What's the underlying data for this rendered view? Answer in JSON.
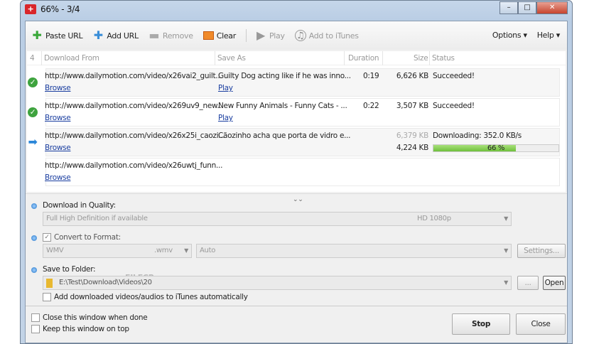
{
  "window": {
    "title": "66% - 3/4"
  },
  "toolbar": {
    "paste_url": "Paste URL",
    "add_url": "Add URL",
    "remove": "Remove",
    "clear": "Clear",
    "play": "Play",
    "add_to_itunes": "Add to iTunes",
    "options": "Options",
    "help": "Help"
  },
  "list": {
    "count": "4",
    "headers": {
      "from": "Download From",
      "save_as": "Save As",
      "duration": "Duration",
      "size": "Size",
      "status": "Status"
    },
    "rows": [
      {
        "url": "http://www.dailymotion.com/video/x26vai2_guilt...",
        "browse": "Browse",
        "save_as": "Guilty Dog acting like if he was inno...",
        "play": "Play",
        "duration": "0:19",
        "size": "6,626 KB",
        "status": "Succeeded!",
        "state": "done"
      },
      {
        "url": "http://www.dailymotion.com/video/x269uv9_new...",
        "browse": "Browse",
        "save_as": "New Funny Animals - Funny Cats - ...",
        "play": "Play",
        "duration": "0:22",
        "size": "3,507 KB",
        "status": "Succeeded!",
        "state": "done"
      },
      {
        "url": "http://www.dailymotion.com/video/x26x25i_caozi...",
        "browse": "Browse",
        "save_as": "Cãozinho acha que porta de vidro e...",
        "total_size": "6,379 KB",
        "size": "4,224 KB",
        "status": "Downloading: 352.0 KB/s",
        "progress": 66,
        "progress_label": "66 %",
        "state": "downloading"
      },
      {
        "url": "http://www.dailymotion.com/video/x26uwtj_funn...",
        "browse": "Browse",
        "state": "queued"
      }
    ]
  },
  "settings": {
    "quality_label": "Download in Quality:",
    "quality_value": "Full High Definition if available",
    "quality_res": "HD 1080p",
    "convert_label": "Convert to Format:",
    "format": "WMV",
    "format_ext": ".wmv",
    "format_option": "Auto",
    "settings_btn": "Settings...",
    "folder_label": "Save to Folder:",
    "folder_path": "E:\\Test\\Download\\Videos\\20",
    "browse_btn": "...",
    "open_btn": "Open",
    "itunes_label": "Add downloaded videos/audios to iTunes automatically",
    "watermark": "FILECR .com"
  },
  "bottom": {
    "close_when_done": "Close this window when done",
    "keep_on_top": "Keep this window on top",
    "stop": "Stop",
    "close": "Close"
  }
}
